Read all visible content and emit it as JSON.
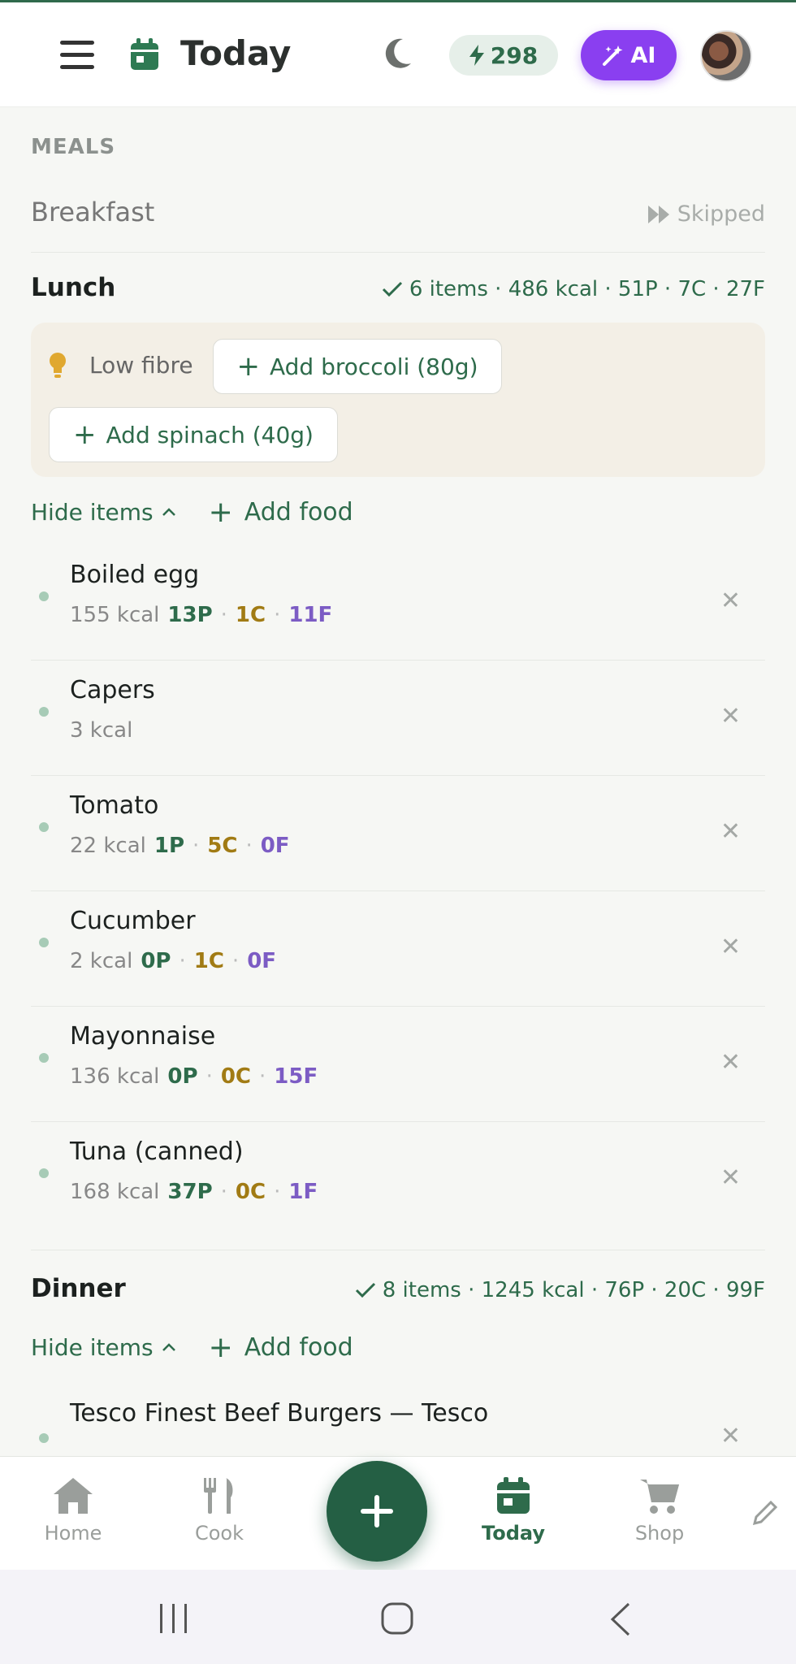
{
  "header": {
    "title": "Today",
    "streak": "298",
    "ai_label": "AI",
    "icons": [
      "menu-icon",
      "calendar-icon",
      "moon-icon",
      "bolt-icon",
      "magic-wand-icon"
    ]
  },
  "meals_label": "MEALS",
  "breakfast": {
    "name": "Breakfast",
    "status": "Skipped"
  },
  "lunch": {
    "name": "Lunch",
    "summary": "6 items · 486 kcal · 51P · 7C · 27F",
    "suggestion_label": "Low fibre",
    "suggestions": [
      "Add broccoli (80g)",
      "Add spinach (40g)"
    ],
    "hide_label": "Hide items",
    "add_label": "Add food",
    "items": [
      {
        "name": "Boiled egg",
        "kcal": "155 kcal",
        "p": "13P",
        "c": "1C",
        "f": "11F"
      },
      {
        "name": "Capers",
        "kcal": "3 kcal",
        "p": "",
        "c": "",
        "f": ""
      },
      {
        "name": "Tomato",
        "kcal": "22 kcal",
        "p": "1P",
        "c": "5C",
        "f": "0F"
      },
      {
        "name": "Cucumber",
        "kcal": "2 kcal",
        "p": "0P",
        "c": "1C",
        "f": "0F"
      },
      {
        "name": "Mayonnaise",
        "kcal": "136 kcal",
        "p": "0P",
        "c": "0C",
        "f": "15F"
      },
      {
        "name": "Tuna (canned)",
        "kcal": "168 kcal",
        "p": "37P",
        "c": "0C",
        "f": "1F"
      }
    ]
  },
  "dinner": {
    "name": "Dinner",
    "summary": "8 items · 1245 kcal · 76P · 20C · 99F",
    "hide_label": "Hide items",
    "add_label": "Add food",
    "items": [
      {
        "name": "Tesco Finest Beef Burgers — Tesco"
      }
    ]
  },
  "nav": {
    "home": "Home",
    "cook": "Cook",
    "today": "Today",
    "shop": "Shop",
    "active": "Today"
  },
  "colors": {
    "primary": "#2e6b4b",
    "ai": "#8a3ff0",
    "protein": "#2e6b4b",
    "carbs": "#a17b14",
    "fat": "#7c5cc4"
  }
}
